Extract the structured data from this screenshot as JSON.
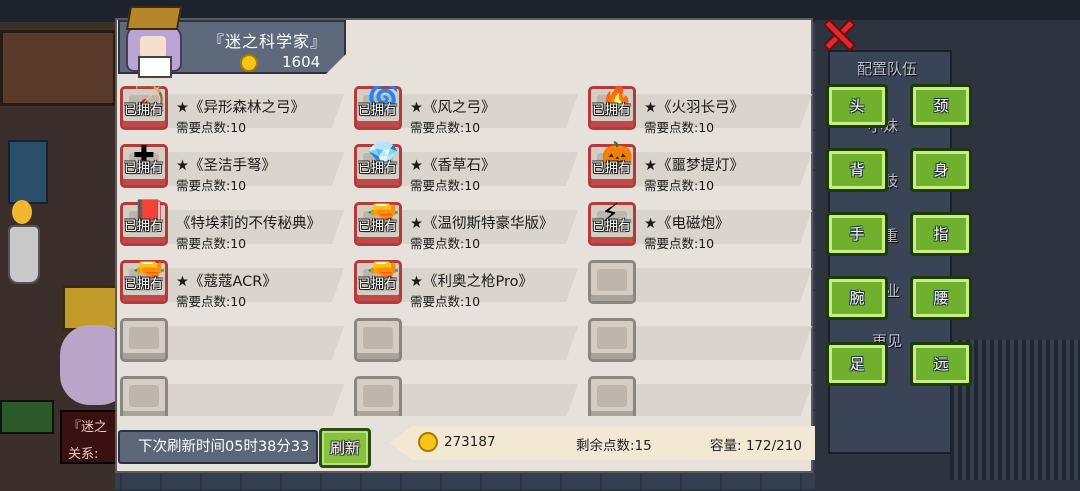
{
  "player": {
    "title": "『迷之科学家』",
    "gold": "1604"
  },
  "owned_label": "已拥有",
  "items": [
    {
      "name": "★《异形森林之弓》",
      "cost": "需要点数:10",
      "owned": true,
      "icon": "alien-bow-icon",
      "glyph": "🏹"
    },
    {
      "name": "★《风之弓》",
      "cost": "需要点数:10",
      "owned": true,
      "icon": "wind-bow-icon",
      "glyph": "🌀"
    },
    {
      "name": "★《火羽长弓》",
      "cost": "需要点数:10",
      "owned": true,
      "icon": "fire-longbow-icon",
      "glyph": "🔥"
    },
    {
      "name": "★《圣洁手弩》",
      "cost": "需要点数:10",
      "owned": true,
      "icon": "holy-crossbow-icon",
      "glyph": "✚"
    },
    {
      "name": "★《香草石》",
      "cost": "需要点数:10",
      "owned": true,
      "icon": "vanilla-stone-icon",
      "glyph": "💎"
    },
    {
      "name": "★《噩梦提灯》",
      "cost": "需要点数:10",
      "owned": true,
      "icon": "nightmare-lantern-icon",
      "glyph": "🎃"
    },
    {
      "name": "《特埃莉的不传秘典》",
      "cost": "需要点数:10",
      "owned": true,
      "icon": "secret-book-icon",
      "glyph": "📕"
    },
    {
      "name": "★《温彻斯特豪华版》",
      "cost": "需要点数:10",
      "owned": true,
      "icon": "winchester-rifle-icon",
      "glyph": "🔫"
    },
    {
      "name": "★《电磁炮》",
      "cost": "需要点数:10",
      "owned": true,
      "icon": "railgun-icon",
      "glyph": "⚡"
    },
    {
      "name": "★《蔻蔻ACR》",
      "cost": "需要点数:10",
      "owned": true,
      "icon": "acr-rifle-icon",
      "glyph": "🔫"
    },
    {
      "name": "★《利奥之枪Pro》",
      "cost": "需要点数:10",
      "owned": true,
      "icon": "leo-gun-icon",
      "glyph": "🔫"
    }
  ],
  "footer": {
    "refresh_timer": "下次刷新时间05时38分33",
    "refresh_button": "刷新",
    "gold": "273187",
    "points_left": "剩余点数:15",
    "capacity": "容量:  172/210"
  },
  "body_parts": [
    "头",
    "颈",
    "背",
    "身",
    "手",
    "指",
    "腕",
    "腰",
    "足",
    "远"
  ],
  "background_text": {
    "team_config": "配置队伍",
    "goodbye": "再见",
    "sign_top": "『迷之",
    "sign_bottom": "关系:",
    "right_partial_1": "小妹",
    "right_partial_2": "朱肢",
    "right_partial_3": "臺重",
    "right_partial_4": "业"
  },
  "colors": {
    "owned_frame": "#b33b3b",
    "button_green": "#6fb02f",
    "close_red": "#e0282d",
    "gold": "#f5c518"
  }
}
